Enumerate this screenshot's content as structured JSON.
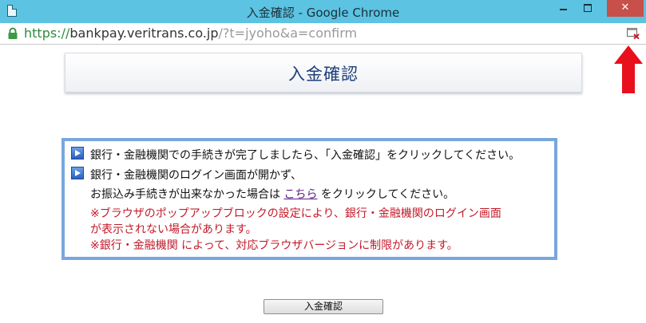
{
  "window": {
    "title": "入金確認 - Google Chrome",
    "close_label": "✕"
  },
  "address_bar": {
    "scheme": "https://",
    "host": "bankpay.veritrans.co.jp",
    "path": "/?t=jyoho&a=confirm"
  },
  "page": {
    "title": "入金確認",
    "instructions": {
      "line1": "銀行・金融機関での手続きが完了しましたら、「入金確認」をクリックしてください。",
      "line2": "銀行・金融機関のログイン画面が開かず、",
      "line3_prefix": "お振込み手続きが出来なかった場合は ",
      "line3_link": "こちら",
      "line3_suffix": " をクリックしてください。",
      "note1_line1": "※ブラウザのポップアップブロックの設定により、銀行・金融機関のログイン画面",
      "note1_line2": "が表示されない場合があります。",
      "note2": "※銀行・金融機関 によって、対応ブラウザバージョンに制限があります。"
    },
    "confirm_button_label": "入金確認"
  },
  "colors": {
    "titlebar": "#5cc3e2",
    "close_button": "#c7504a",
    "box_border": "#79a7dc",
    "warning_text": "#c21a2a",
    "annotation_arrow": "#e8101c"
  },
  "icons": {
    "lock": "lock-icon",
    "popup_blocked": "popup-blocked-icon",
    "bullet": "play-bullet-icon",
    "annotation": "red-arrow-icon"
  }
}
